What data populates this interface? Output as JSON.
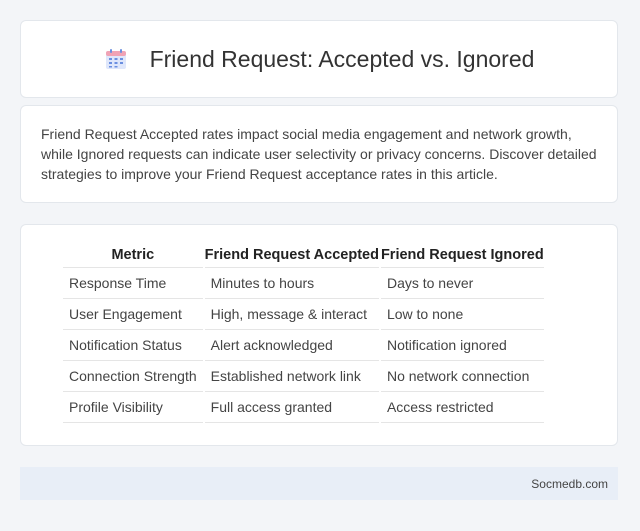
{
  "header": {
    "icon": "calendar-icon",
    "title": "Friend Request: Accepted vs. Ignored"
  },
  "intro": {
    "text": "Friend Request Accepted rates impact social media engagement and network growth, while Ignored requests can indicate user selectivity or privacy concerns. Discover detailed strategies to improve your Friend Request acceptance rates in this article."
  },
  "table": {
    "headers": [
      "Metric",
      "Friend Request Accepted",
      "Friend Request Ignored"
    ],
    "rows": [
      [
        "Response Time",
        "Minutes to hours",
        "Days to never"
      ],
      [
        "User Engagement",
        "High, message & interact",
        "Low to none"
      ],
      [
        "Notification Status",
        "Alert acknowledged",
        "Notification ignored"
      ],
      [
        "Connection Strength",
        "Established network link",
        "No network connection"
      ],
      [
        "Profile Visibility",
        "Full access granted",
        "Access restricted"
      ]
    ]
  },
  "footer": {
    "site": "Socmedb.com"
  },
  "colors": {
    "accent_blue": "#6b8fe0",
    "accent_pink": "#f0a3b5",
    "footer_bg": "#e8eef7"
  }
}
